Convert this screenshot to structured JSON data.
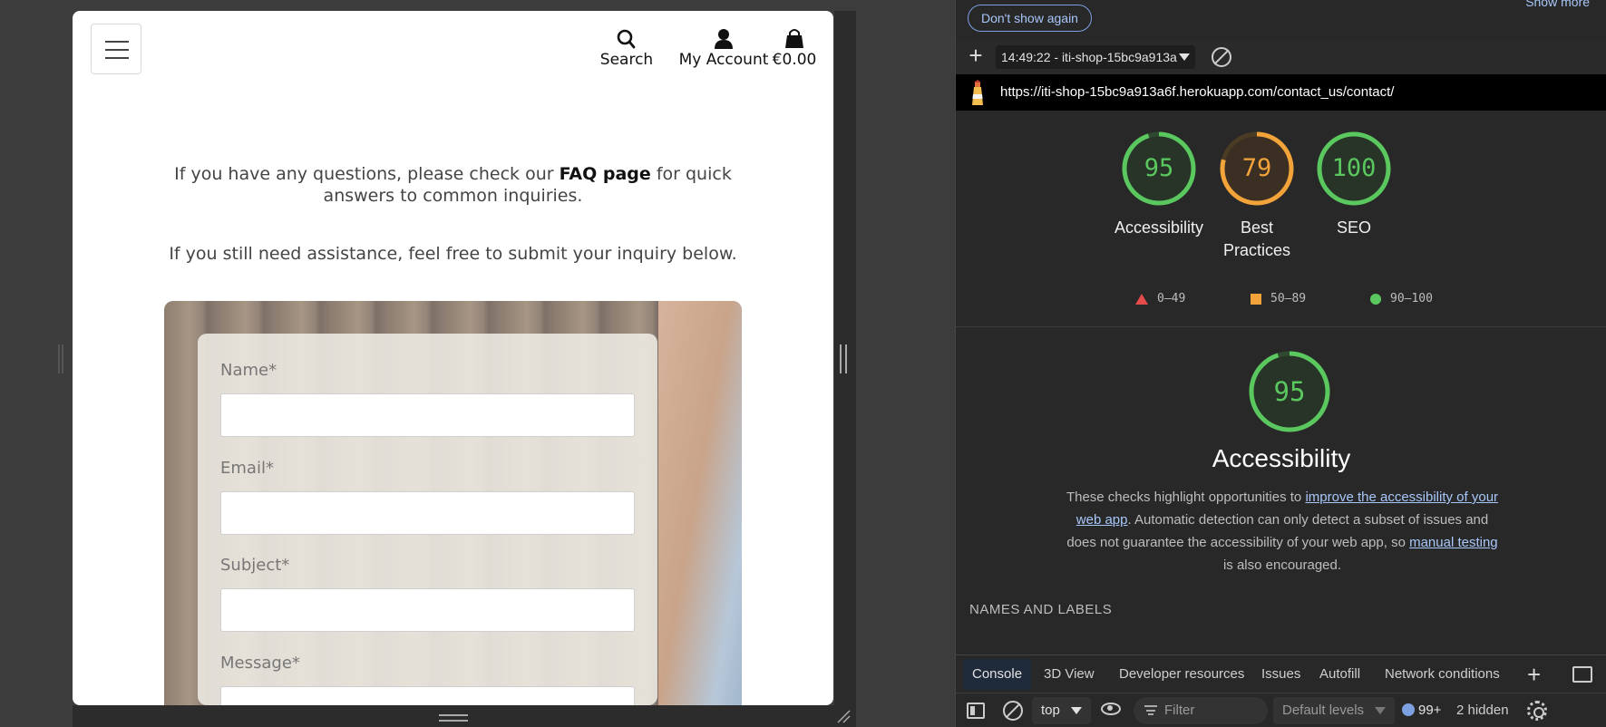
{
  "site": {
    "nav": {
      "search_label": "Search",
      "account_label": "My Account",
      "cart_total": "€0.00"
    },
    "intro": {
      "line1_pre": "If you have any questions, please check our ",
      "faq_link": "FAQ page",
      "line1_post": " for quick answers to common inquiries.",
      "line2": "If you still need assistance, feel free to submit your inquiry below."
    },
    "form": {
      "name_label": "Name*",
      "email_label": "Email*",
      "subject_label": "Subject*",
      "message_label": "Message*"
    }
  },
  "devtools": {
    "dont_show_again": "Don't show again",
    "show_more": "Show more",
    "report_select": "14:49:22 - iti-shop-15bc9a913a",
    "url": "https://iti-shop-15bc9a913a6f.herokuapp.com/contact_us/contact/",
    "scores": [
      {
        "name": "Accessibility",
        "value": "95",
        "fraction": 0.95,
        "color": "#5ac85f"
      },
      {
        "name": "Best Practices",
        "value": "79",
        "fraction": 0.79,
        "color": "#f2a33a"
      },
      {
        "name": "SEO",
        "value": "100",
        "fraction": 1.0,
        "color": "#5ac85f"
      }
    ],
    "legend": [
      {
        "range": "0–49",
        "color": "#e54b4b",
        "shape": "triangle"
      },
      {
        "range": "50–89",
        "color": "#f2a33a",
        "shape": "square"
      },
      {
        "range": "90–100",
        "color": "#5ac85f",
        "shape": "circle"
      }
    ],
    "section": {
      "score": "95",
      "fraction": 0.95,
      "title": "Accessibility",
      "desc_1": "These checks highlight opportunities to ",
      "desc_link_1": "improve the accessibility of your web app",
      "desc_2": ". Automatic detection can only detect a subset of issues and does not guarantee the accessibility of your web app, so ",
      "desc_link_2": "manual testing",
      "desc_3": " is also encouraged.",
      "group_heading": "NAMES AND LABELS"
    },
    "drawer_tabs": [
      "Console",
      "3D View",
      "Developer resources",
      "Issues",
      "Autofill",
      "Network conditions"
    ],
    "console": {
      "context": "top",
      "filter_placeholder": "Filter",
      "levels": "Default levels",
      "message_count": "99+",
      "hidden": "2 hidden"
    }
  }
}
